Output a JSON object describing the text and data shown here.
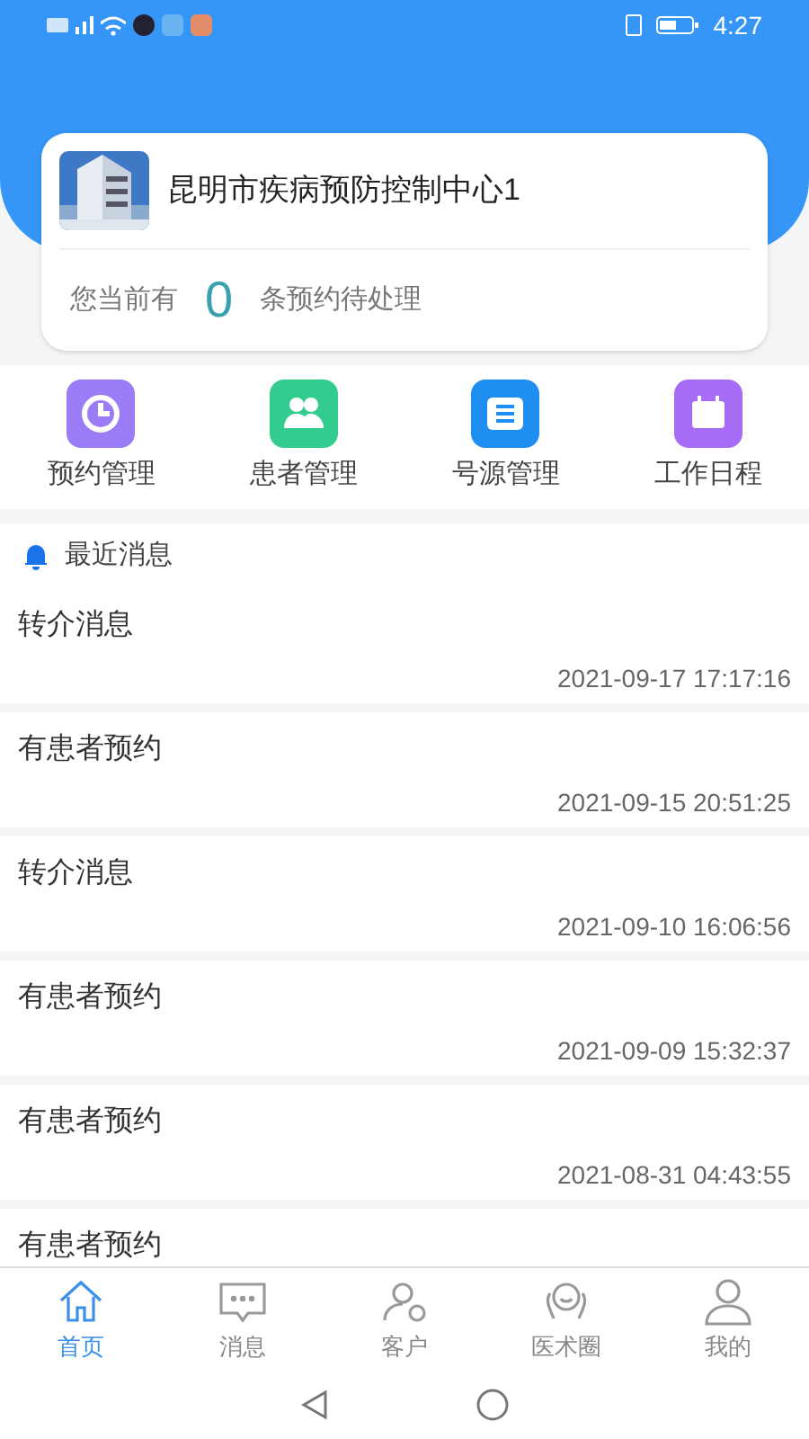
{
  "status_bar": {
    "time": "4:27"
  },
  "org_card": {
    "name": "昆明市疾病预防控制中心1",
    "pending_prefix": "您当前有",
    "pending_count": "0",
    "pending_suffix": "条预约待处理"
  },
  "shortcuts": [
    {
      "label": "预约管理",
      "kind": "clock",
      "color": "#9a7cf6"
    },
    {
      "label": "患者管理",
      "kind": "people",
      "color": "#33cc8f"
    },
    {
      "label": "号源管理",
      "kind": "ticket",
      "color": "#1e8ff0"
    },
    {
      "label": "工作日程",
      "kind": "calendar",
      "color": "#a66cf5"
    }
  ],
  "recent": {
    "title": "最近消息",
    "messages": [
      {
        "title": "转介消息",
        "time": "2021-09-17 17:17:16"
      },
      {
        "title": "有患者预约",
        "time": "2021-09-15 20:51:25"
      },
      {
        "title": "转介消息",
        "time": "2021-09-10 16:06:56"
      },
      {
        "title": "有患者预约",
        "time": "2021-09-09 15:32:37"
      },
      {
        "title": "有患者预约",
        "time": "2021-08-31 04:43:55"
      },
      {
        "title": "有患者预约"
      }
    ]
  },
  "tab_bar": [
    {
      "label": "首页",
      "kind": "home",
      "selected": true
    },
    {
      "label": "消息",
      "kind": "chat",
      "selected": false
    },
    {
      "label": "客户",
      "kind": "client",
      "selected": false
    },
    {
      "label": "医术圈",
      "kind": "circle",
      "selected": false
    },
    {
      "label": "我的",
      "kind": "user",
      "selected": false
    }
  ]
}
